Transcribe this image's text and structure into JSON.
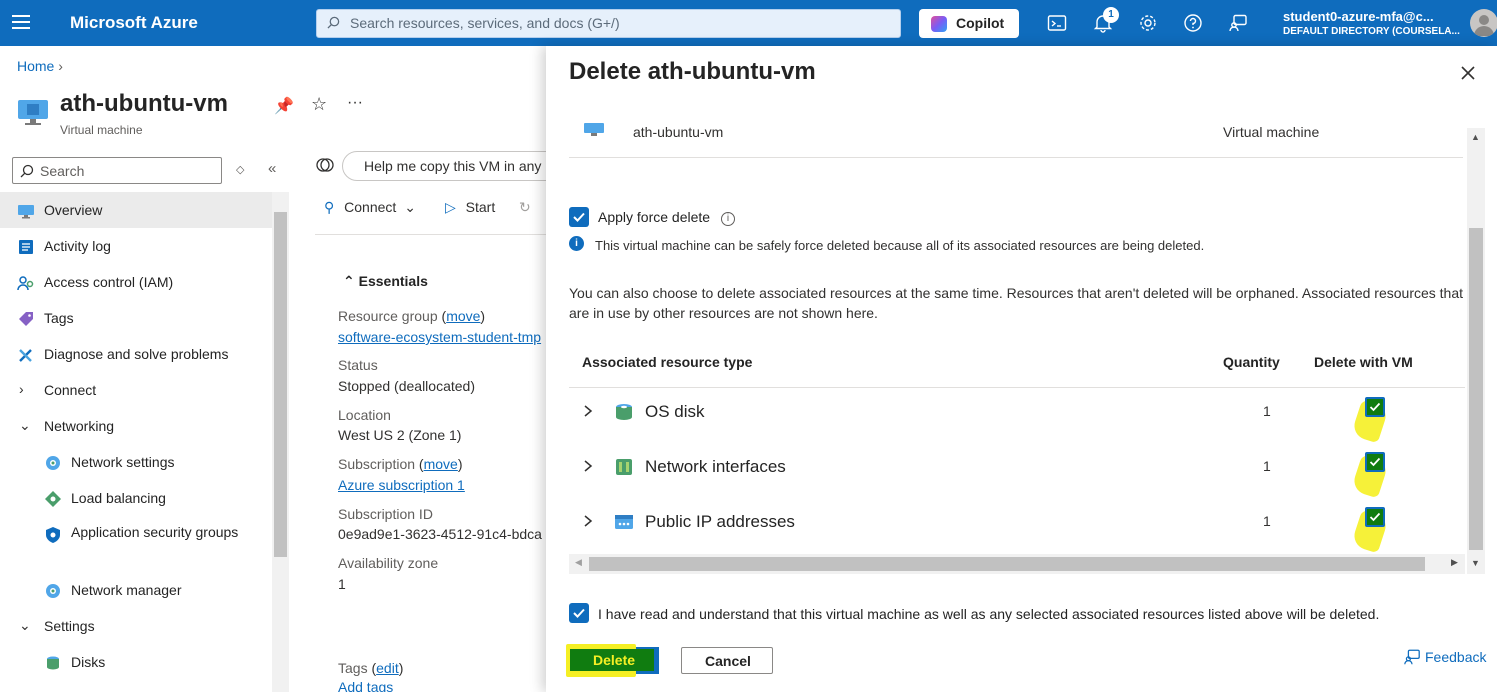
{
  "topbar": {
    "brand": "Microsoft Azure",
    "search_placeholder": "Search resources, services, and docs (G+/)",
    "copilot_label": "Copilot",
    "notification_count": "1",
    "account_name": "student0-azure-mfa@c...",
    "account_directory": "DEFAULT DIRECTORY (COURSELA..."
  },
  "background": {
    "breadcrumb": "Home",
    "title": "ath-ubuntu-vm",
    "subtitle": "Virtual machine",
    "side_search": "Search",
    "nav": [
      {
        "label": "Overview",
        "icon": "vm-icon"
      },
      {
        "label": "Activity log",
        "icon": "activity-log-icon"
      },
      {
        "label": "Access control (IAM)",
        "icon": "iam-icon"
      },
      {
        "label": "Tags",
        "icon": "tag-icon"
      },
      {
        "label": "Diagnose and solve problems",
        "icon": "diagnose-icon"
      },
      {
        "label": "Connect",
        "icon": "chevron-right-icon"
      },
      {
        "label": "Networking",
        "icon": "chevron-down-icon"
      },
      {
        "label": "Network settings",
        "icon": "network-settings-icon"
      },
      {
        "label": "Load balancing",
        "icon": "load-balancing-icon"
      },
      {
        "label": "Application security groups",
        "icon": "asg-icon"
      },
      {
        "label": "Network manager",
        "icon": "network-manager-icon"
      },
      {
        "label": "Settings",
        "icon": "chevron-down-icon"
      },
      {
        "label": "Disks",
        "icon": "disk-icon"
      }
    ],
    "help_pill": "Help me copy this VM in any",
    "commands": {
      "connect": "Connect",
      "start": "Start"
    },
    "essentials_label": "Essentials",
    "essentials": {
      "rg_label": "Resource group",
      "rg_move": "move",
      "rg_value": "software-ecosystem-student-tmp",
      "status_label": "Status",
      "status_value": "Stopped (deallocated)",
      "location_label": "Location",
      "location_value": "West US 2 (Zone 1)",
      "subscription_label": "Subscription",
      "subscription_move": "move",
      "subscription_value": "Azure subscription 1",
      "subid_label": "Subscription ID",
      "subid_value": "0e9ad9e1-3623-4512-91c4-bdca",
      "az_label": "Availability zone",
      "az_value": "1",
      "tags_label": "Tags",
      "tags_edit": "edit",
      "add_tags": "Add tags"
    }
  },
  "dialog": {
    "title": "Delete ath-ubuntu-vm",
    "vm_name": "ath-ubuntu-vm",
    "vm_type": "Virtual machine",
    "force_delete_label": "Apply force delete",
    "force_delete_info": "This virtual machine can be safely force deleted because all of its associated resources are being deleted.",
    "description": "You can also choose to delete associated resources at the same time. Resources that aren't deleted will be orphaned. Associated resources that are in use by other resources are not shown here.",
    "table": {
      "headers": {
        "type": "Associated resource type",
        "quantity": "Quantity",
        "delete_with_vm": "Delete with VM"
      },
      "rows": [
        {
          "name": "OS disk",
          "quantity": "1",
          "checked": true
        },
        {
          "name": "Network interfaces",
          "quantity": "1",
          "checked": true
        },
        {
          "name": "Public IP addresses",
          "quantity": "1",
          "checked": true
        }
      ]
    },
    "confirm_label": "I have read and understand that this virtual machine as well as any selected associated resources listed above will be deleted.",
    "delete_label": "Delete",
    "cancel_label": "Cancel",
    "feedback_label": "Feedback"
  }
}
